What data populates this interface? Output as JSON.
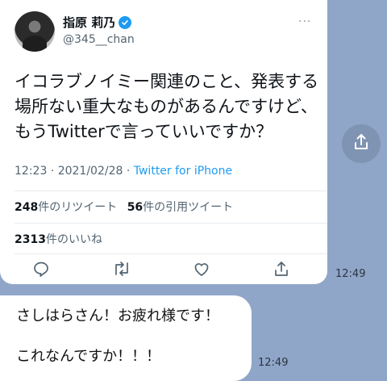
{
  "tweet": {
    "author_name": "指原 莉乃",
    "handle": "@345__chan",
    "more": "···",
    "text_lines": [
      "イコラブノイミー関連のこと、発表する",
      "場所ない重大なものがあるんですけど、",
      "もうTwitterで言っていいですか？"
    ],
    "timestamp": "12:23 · 2021/02/28 · ",
    "source": "Twitter for iPhone",
    "retweets_count": "248",
    "retweets_label": "件のリツイート",
    "quotes_count": "56",
    "quotes_label": "件の引用ツイート",
    "likes_count": "2313",
    "likes_label": "件のいいね",
    "actions": [
      "reply-icon",
      "retweet-icon",
      "like-icon",
      "share-icon"
    ],
    "colors": {
      "verified": "#1d9bf0",
      "link": "#1d9bf0"
    }
  },
  "chat": {
    "tweet_time": "12:49",
    "message_lines": [
      "さしはらさん！お疲れ様です！",
      "これなんですか！！！"
    ],
    "message_time": "12:49",
    "share_button_icon": "share-icon",
    "background_color": "#8fa6c9"
  }
}
